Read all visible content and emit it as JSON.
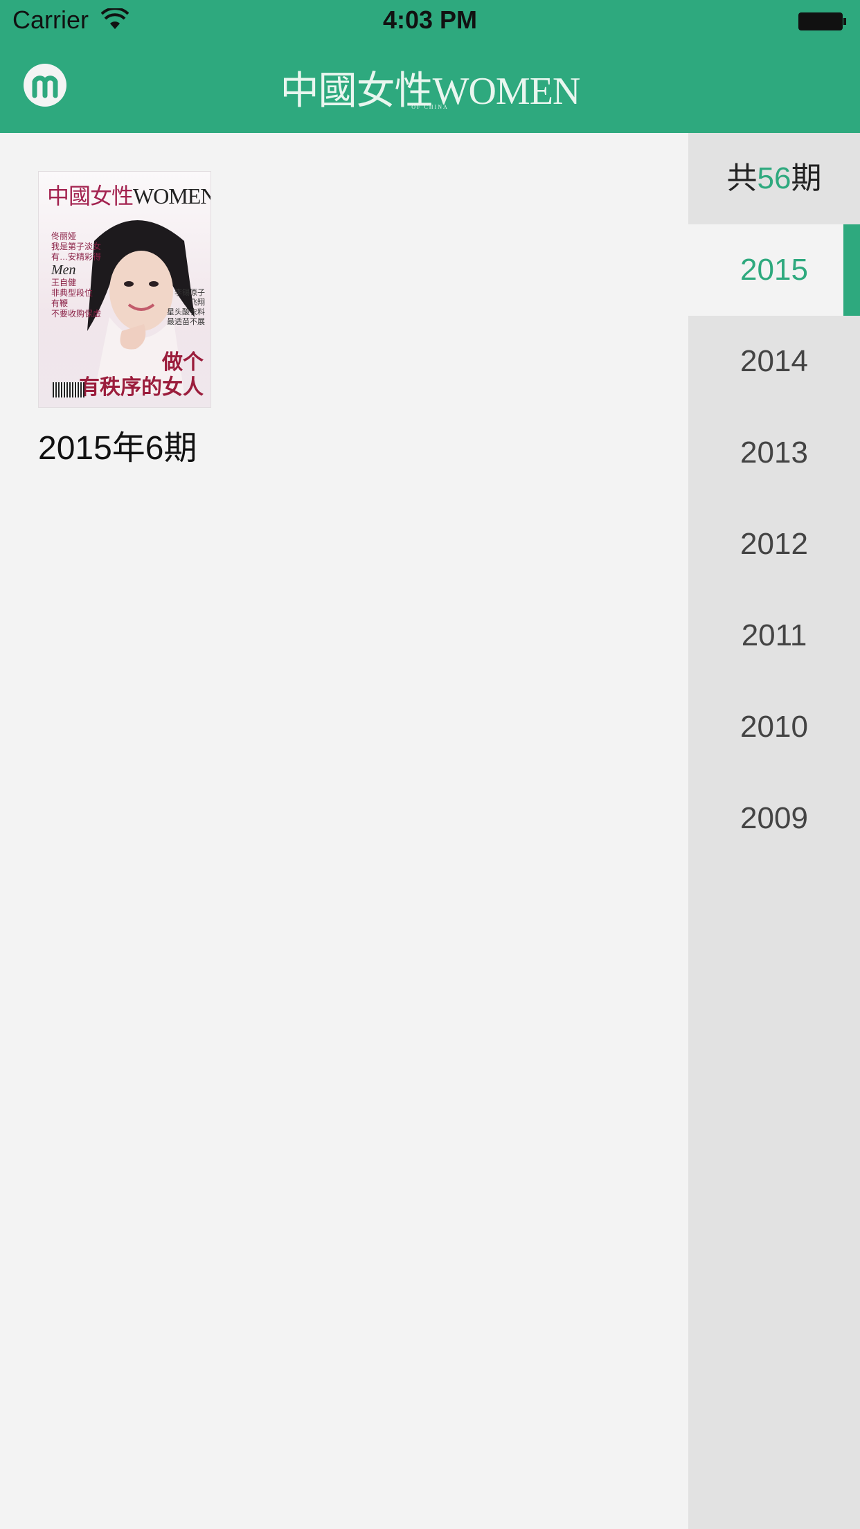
{
  "status_bar": {
    "carrier": "Carrier",
    "time": "4:03 PM"
  },
  "nav": {
    "brand_cn": "中國女性",
    "brand_en": "WOMEN",
    "brand_sub": "OF CHINA",
    "accent_color": "#2ea97e"
  },
  "issues": [
    {
      "label": "2015年6期",
      "cover": {
        "masthead_cn": "中國女性",
        "masthead_en": "WOMEN",
        "left_lines": [
          "佟丽娅",
          "我是第子淡女",
          "有…安精彩得"
        ],
        "men_word": "Men",
        "left_lines2": [
          "王自健",
          "非典型段位",
          "有鞭",
          "不要收购保虚"
        ],
        "right_lines": [
          "李锡原子",
          "飞翔",
          "星头酸衣料",
          "最适苗不展"
        ],
        "headline_1": "做个",
        "headline_2": "有秩序的女人"
      }
    }
  ],
  "sidebar": {
    "total_prefix": "共",
    "total_count": "56",
    "total_suffix": "期",
    "years": [
      "2015",
      "2014",
      "2013",
      "2012",
      "2011",
      "2010",
      "2009"
    ],
    "selected_year": "2015"
  }
}
